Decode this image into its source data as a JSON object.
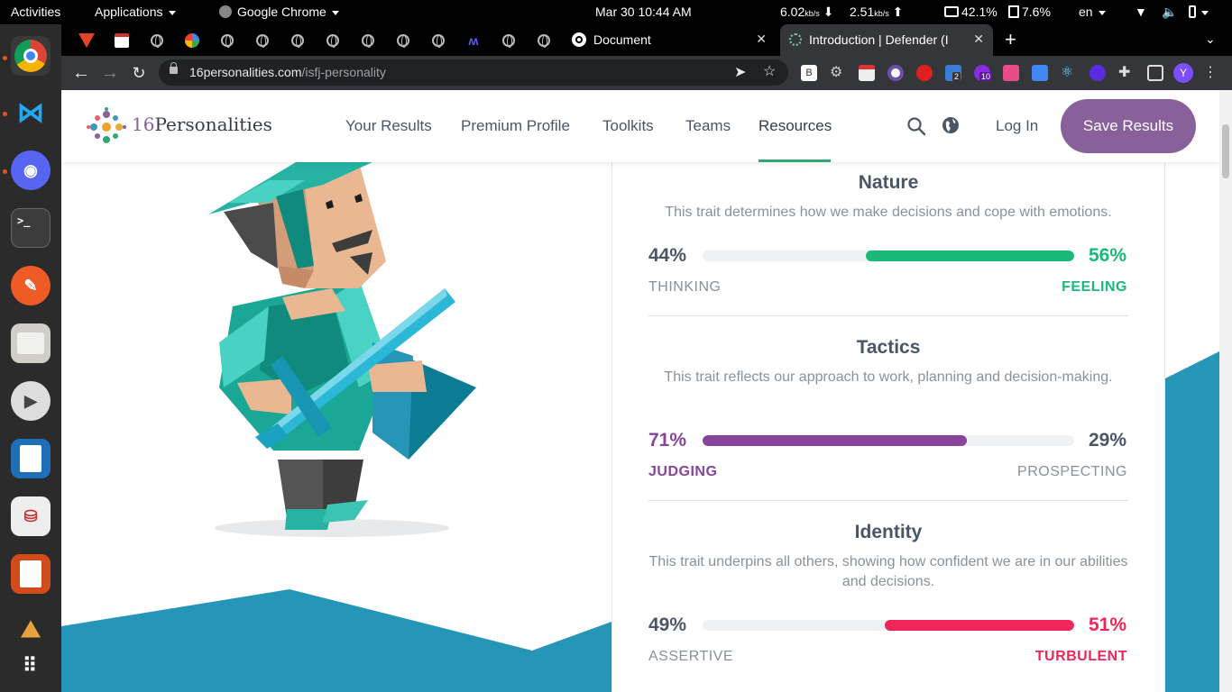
{
  "system_bar": {
    "activities": "Activities",
    "applications": "Applications",
    "app_name": "Google Chrome",
    "datetime": "Mar 30  10:44 AM",
    "net_up": "6.02",
    "net_up_unit": "kb/s",
    "net_down": "2.51",
    "net_down_unit": "kb/s",
    "cpu": "42.1%",
    "mem": "7.6%",
    "lang": "en"
  },
  "browser": {
    "tabs": [
      {
        "title": "Document",
        "close": "✕"
      },
      {
        "title": "Introduction | Defender (I",
        "close": "✕",
        "active": true
      }
    ],
    "new_tab": "+",
    "url_host": "16personalities.com",
    "url_path": "/isfj-personality",
    "ext_badges": [
      "2",
      "10"
    ],
    "profile_initial": "Y"
  },
  "site": {
    "logo_number": "16",
    "logo_word": "Personalities",
    "nav": [
      "Your Results",
      "Premium Profile",
      "Toolkits",
      "Teams",
      "Resources"
    ],
    "active_nav": "Resources",
    "login": "Log In",
    "save": "Save Results"
  },
  "traits": [
    {
      "title": "Nature",
      "description": "This trait determines how we make decisions and cope with emotions.",
      "left_pct": "44%",
      "left_label": "THINKING",
      "right_pct": "56%",
      "right_label": "FEELING",
      "dominant": "right",
      "fill_fraction": 0.56,
      "color": "#1ab97a"
    },
    {
      "title": "Tactics",
      "description": "This trait reflects our approach to work, planning and decision-making.",
      "left_pct": "71%",
      "left_label": "JUDGING",
      "right_pct": "29%",
      "right_label": "PROSPECTING",
      "dominant": "left",
      "fill_fraction": 0.71,
      "color": "#88449a"
    },
    {
      "title": "Identity",
      "description": "This trait underpins all others, showing how confident we are in our abilities and decisions.",
      "left_pct": "49%",
      "left_label": "ASSERTIVE",
      "right_pct": "51%",
      "right_label": "TURBULENT",
      "dominant": "right",
      "fill_fraction": 0.51,
      "color": "#f0265a"
    }
  ],
  "colors": {
    "muted": "#8a919d",
    "text": "#4b5567",
    "accent_bg": "#2596b7",
    "save_button": "#88619a"
  }
}
